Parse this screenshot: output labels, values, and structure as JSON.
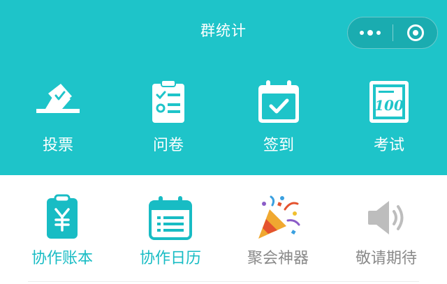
{
  "header": {
    "title": "群统计"
  },
  "capsule": {
    "more_icon": "more-dots-icon",
    "close_icon": "close-circle-icon"
  },
  "colors": {
    "brand": "#1ec4c9",
    "teal_text": "#18bcc4",
    "gray_text": "#8a8a8a"
  },
  "top_actions": [
    {
      "label": "投票",
      "icon": "ballot-box-icon"
    },
    {
      "label": "问卷",
      "icon": "questionnaire-clipboard-icon"
    },
    {
      "label": "签到",
      "icon": "calendar-check-icon"
    },
    {
      "label": "考试",
      "icon": "exam-paper-100-icon"
    }
  ],
  "tools": [
    {
      "label": "协作账本",
      "icon": "yen-ledger-icon"
    },
    {
      "label": "协作日历",
      "icon": "calendar-list-icon"
    },
    {
      "label": "聚会神器",
      "icon": "party-popper-icon"
    },
    {
      "label": "敬请期待",
      "icon": "speaker-icon"
    }
  ]
}
